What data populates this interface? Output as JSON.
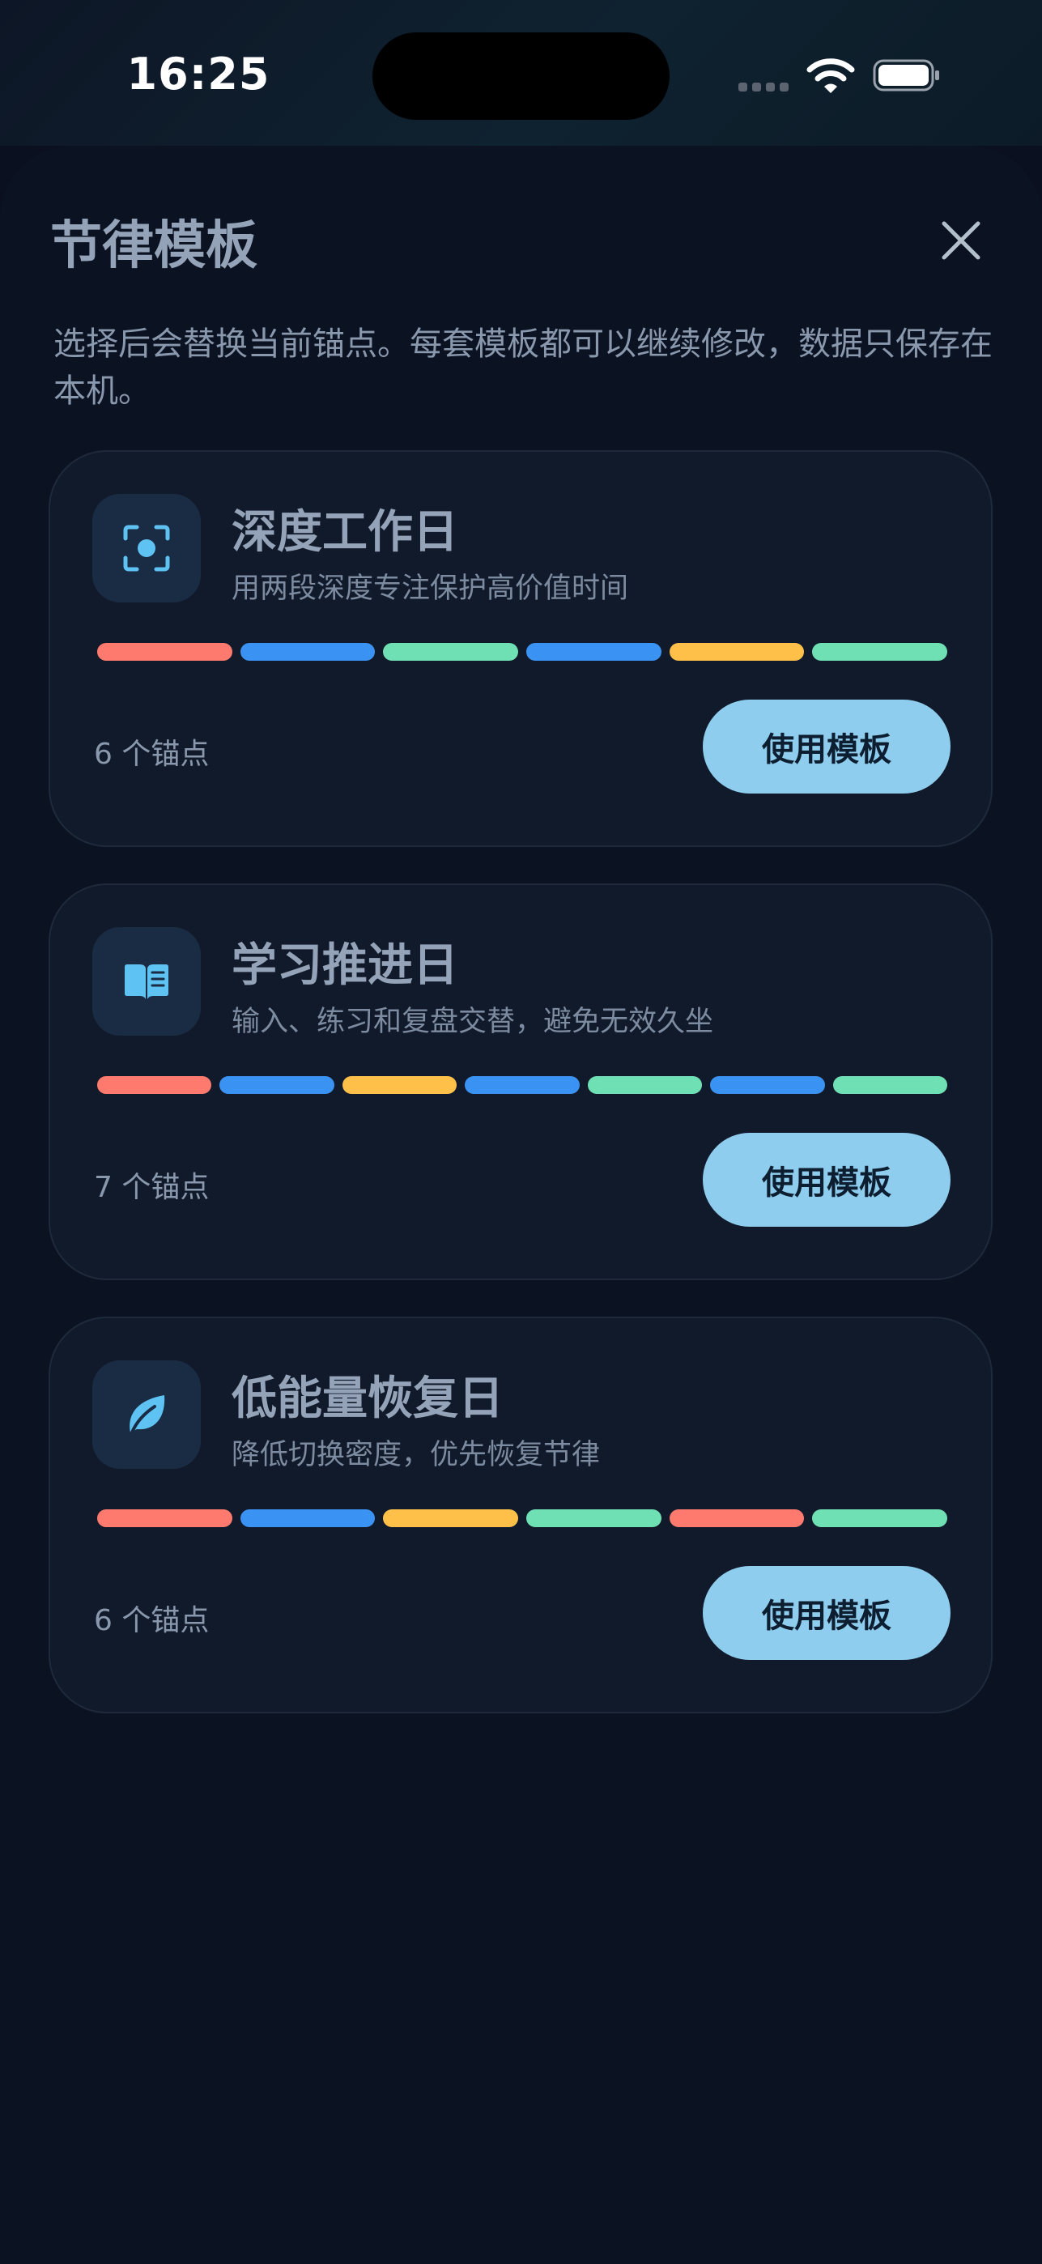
{
  "status_bar": {
    "time": "16:25"
  },
  "sheet": {
    "title": "节律模板",
    "subtitle": "选择后会替换当前锚点。每套模板都可以继续修改，数据只保存在本机。"
  },
  "colors": {
    "red": "#ff7a6e",
    "blue": "#3a93f2",
    "green": "#6fe0b4",
    "yellow": "#ffc04a",
    "button": "#8fcdee"
  },
  "templates": [
    {
      "icon": "focus-icon",
      "title": "深度工作日",
      "description": "用两段深度专注保护高价值时间",
      "segments": [
        "red",
        "blue",
        "green",
        "blue",
        "yellow",
        "green"
      ],
      "anchor_count": "6 个锚点",
      "button_label": "使用模板"
    },
    {
      "icon": "book-icon",
      "title": "学习推进日",
      "description": "输入、练习和复盘交替，避免无效久坐",
      "segments": [
        "red",
        "blue",
        "yellow",
        "blue",
        "green",
        "blue",
        "green"
      ],
      "anchor_count": "7 个锚点",
      "button_label": "使用模板"
    },
    {
      "icon": "leaf-icon",
      "title": "低能量恢复日",
      "description": "降低切换密度，优先恢复节律",
      "segments": [
        "red",
        "blue",
        "yellow",
        "green",
        "red",
        "green"
      ],
      "anchor_count": "6 个锚点",
      "button_label": "使用模板"
    }
  ]
}
